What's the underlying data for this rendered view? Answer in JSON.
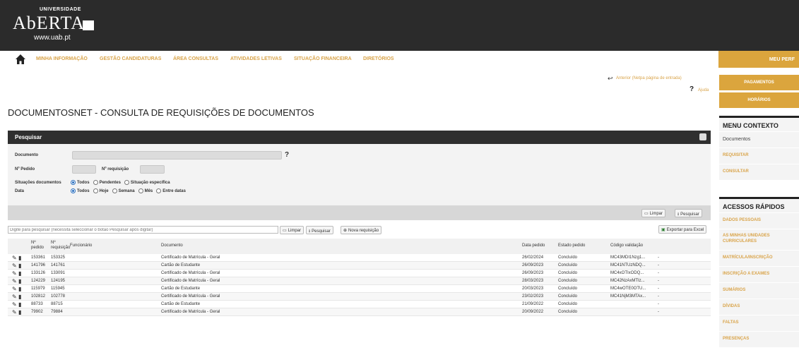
{
  "header": {
    "uni": "UNIVERSIDADE",
    "brand": "AbERTA",
    "url": "www.uab.pt"
  },
  "nav": {
    "items": [
      "MINHA INFORMAÇÃO",
      "GESTÃO CANDIDATURAS",
      "ÁREA CONSULTAS",
      "ATIVIDADES LETIVAS",
      "SITUAÇÃO FINANCEIRA",
      "DIRETÓRIOS"
    ],
    "right": "MEU PERF"
  },
  "links": {
    "back": "Anterior (Netpa página de entrada)",
    "help": "Ajuda"
  },
  "sidebar": {
    "buttons": [
      "PAGAMENTOS",
      "HORÁRIOS"
    ],
    "context_title": "MENU CONTEXTO",
    "context_items": [
      "Documentos",
      "REQUISITAR",
      "CONSULTAR"
    ],
    "quick_title": "ACESSOS RÁPIDOS",
    "quick_items": [
      "DADOS PESSOAIS",
      "AS MINHAS UNIDADES CURRICULARES",
      "MATRÍCULA/INSCRIÇÃO",
      "INSCRIÇÃO A EXAMES",
      "SUMÁRIOS",
      "DÍVIDAS",
      "FALTAS",
      "PRESENÇAS"
    ]
  },
  "page_title": "DOCUMENTOSNET - CONSULTA DE REQUISIÇÕES DE DOCUMENTOS",
  "search": {
    "title": "Pesquisar",
    "documento_label": "Documento",
    "pedido_label": "Nº Pedido",
    "requisicao_label": "Nº requisição",
    "situacoes_label": "Situações documentos",
    "situacoes_options": [
      "Todos",
      "Pendentes",
      "Situação específica"
    ],
    "data_label": "Data",
    "data_options": [
      "Todos",
      "Hoje",
      "Semana",
      "Mês",
      "Entre datas"
    ],
    "limpar": "Limpar",
    "pesquisar": "Pesquisar"
  },
  "filter": {
    "placeholder": "Digite para pesquisar (necessita seleccionar o botão Pesquisar após digitar)",
    "limpar": "Limpar",
    "pesquisar": "Pesquisar",
    "nova": "Nova requisição",
    "excel": "Exportar para Excel"
  },
  "table": {
    "headers": {
      "pedido": "Nº pedido",
      "requisicao": "Nº requisição",
      "funcionario": "Funcionário",
      "documento": "Documento",
      "data": "Data pedido",
      "estado": "Estado pedido",
      "codigo": "Código validação"
    },
    "rows": [
      {
        "pedido": "153361",
        "req": "153325",
        "doc": "Certificado de Matrícula - Geral",
        "data": "26/02/2024",
        "estado": "Concluído",
        "codigo": "MC43MDI1Nzg1...",
        "extra": "-"
      },
      {
        "pedido": "141796",
        "req": "141761",
        "doc": "Cartão de Estudante",
        "data": "26/09/2023",
        "estado": "Concluído",
        "codigo": "MC41NTUzNDQ...",
        "extra": "-"
      },
      {
        "pedido": "133126",
        "req": "133091",
        "doc": "Certificado de Matrícula - Geral",
        "data": "26/09/2023",
        "estado": "Concluído",
        "codigo": "MC4xOTIxODQ...",
        "extra": "-"
      },
      {
        "pedido": "124229",
        "req": "124195",
        "doc": "Certificado de Matrícula - Geral",
        "data": "28/03/2023",
        "estado": "Concluído",
        "codigo": "MC42NzAxMTIz...",
        "extra": "-"
      },
      {
        "pedido": "115979",
        "req": "115945",
        "doc": "Cartão de Estudante",
        "data": "20/03/2023",
        "estado": "Concluído",
        "codigo": "MC4wOTE0OTU...",
        "extra": "-"
      },
      {
        "pedido": "102812",
        "req": "102778",
        "doc": "Certificado de Matrícula - Geral",
        "data": "23/02/2023",
        "estado": "Concluído",
        "codigo": "MC41NjM3MTAx...",
        "extra": "-"
      },
      {
        "pedido": "88733",
        "req": "88715",
        "doc": "Cartão de Estudante",
        "data": "21/09/2022",
        "estado": "Concluído",
        "codigo": "",
        "extra": "-"
      },
      {
        "pedido": "79902",
        "req": "79884",
        "doc": "Certificado de Matrícula - Geral",
        "data": "20/09/2022",
        "estado": "Concluído",
        "codigo": "",
        "extra": "-"
      }
    ]
  },
  "colors": {
    "header_bg": "#2b2b2b",
    "accent": "#dba53d",
    "nav_text": "#d9a44a"
  }
}
